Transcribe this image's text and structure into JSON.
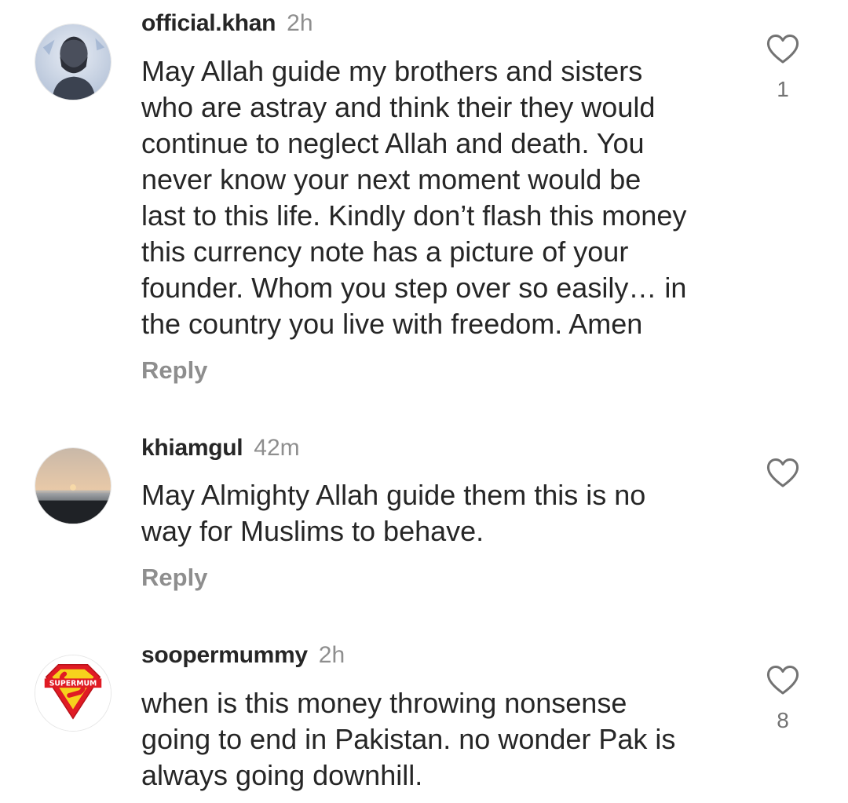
{
  "comments": [
    {
      "username": "official.khan",
      "time": "2h",
      "text": "May Allah guide my brothers and sisters\nwho are astray and think their they would\ncontinue to neglect Allah and death. You\nnever know your next moment would be\nlast to this life. Kindly don’t flash this money\nthis currency note has a picture of your\nfounder. Whom you step over so easily… in\nthe country you live with freedom. Amen",
      "reply_label": "Reply",
      "like_icon": "heart-outline-icon",
      "likes": "1"
    },
    {
      "username": "khiamgul",
      "time": "42m",
      "text": "May Almighty Allah guide them this is no\nway for Muslims to behave.",
      "reply_label": "Reply",
      "like_icon": "heart-outline-icon",
      "likes": ""
    },
    {
      "username": "soopermummy",
      "time": "2h",
      "text": "when is this money throwing nonsense\ngoing to end in Pakistan. no wonder Pak is\nalways going downhill.",
      "avatar_text": "SUPERMUM",
      "like_icon": "heart-outline-icon",
      "likes": "8"
    }
  ],
  "colors": {
    "text_primary": "#262626",
    "text_secondary": "#8e8e8e",
    "background": "#ffffff"
  }
}
